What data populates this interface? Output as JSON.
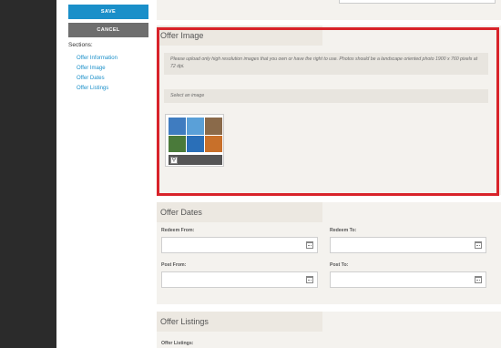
{
  "sidebar": {
    "save_label": "SAVE",
    "cancel_label": "CANCEL",
    "sections_label": "Sections:",
    "sections": [
      {
        "label": "Offer Information"
      },
      {
        "label": "Offer Image"
      },
      {
        "label": "Offer Dates"
      },
      {
        "label": "Offer Listings"
      }
    ]
  },
  "offer_image": {
    "title": "Offer Image",
    "help_text": "Please upload only high resolution images that you own or have the right to use. Photos should be a landscape oriented photo 1900 x 760 pixels at 72 dpi.",
    "select_placeholder": "Select an image",
    "thumb_colors": [
      "#3f7cc0",
      "#5aa0d8",
      "#8a6a4a",
      "#4a7a3a",
      "#2a6fb8",
      "#c8702a"
    ],
    "highlight_color": "#d8232a"
  },
  "offer_dates": {
    "title": "Offer Dates",
    "redeem_from_label": "Redeem From:",
    "redeem_to_label": "Redeem To:",
    "post_from_label": "Post From:",
    "post_to_label": "Post To:"
  },
  "offer_listings": {
    "title": "Offer Listings",
    "label": "Offer Listings:"
  },
  "colors": {
    "accent": "#1a8fc9",
    "dark_sidebar": "#2b2b2b",
    "panel_bg": "#f4f2ee"
  }
}
